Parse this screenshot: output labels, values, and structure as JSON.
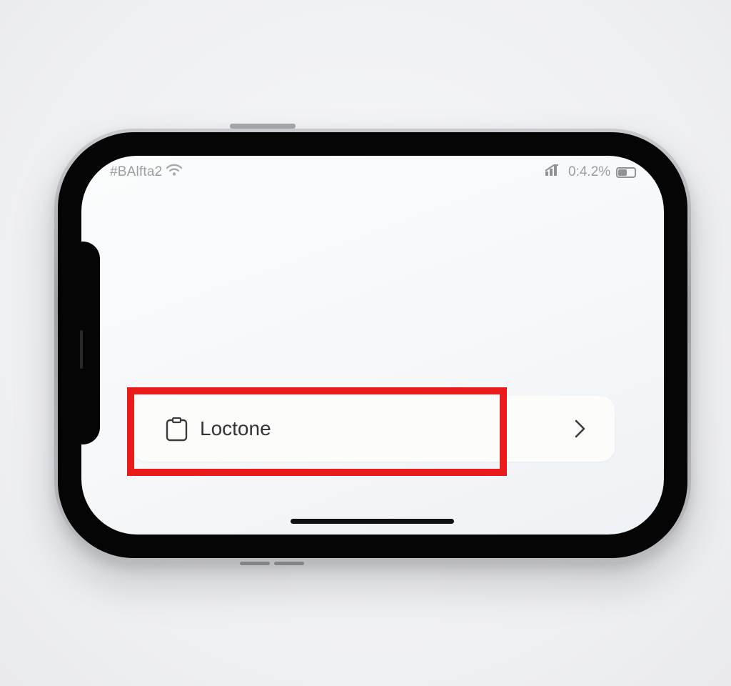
{
  "status_bar": {
    "carrier": "#BAlfta2",
    "wifi_icon": "wifi-icon",
    "signal_icon": "signal-icon",
    "time": "0:4.2%",
    "battery_level": 0.55,
    "battery_icon": "battery-icon"
  },
  "list": {
    "items": [
      {
        "label": "Loctone",
        "icon": "clipboard-icon",
        "trailing_icon": "chevron-right-icon"
      }
    ]
  },
  "highlight": {
    "color": "#ea1b1b",
    "target": "list.items.0"
  },
  "colors": {
    "screen_background": "#f7f8fa",
    "row_background": "#fcfcfb",
    "text": "#333436",
    "status_text": "#9a9da2"
  }
}
